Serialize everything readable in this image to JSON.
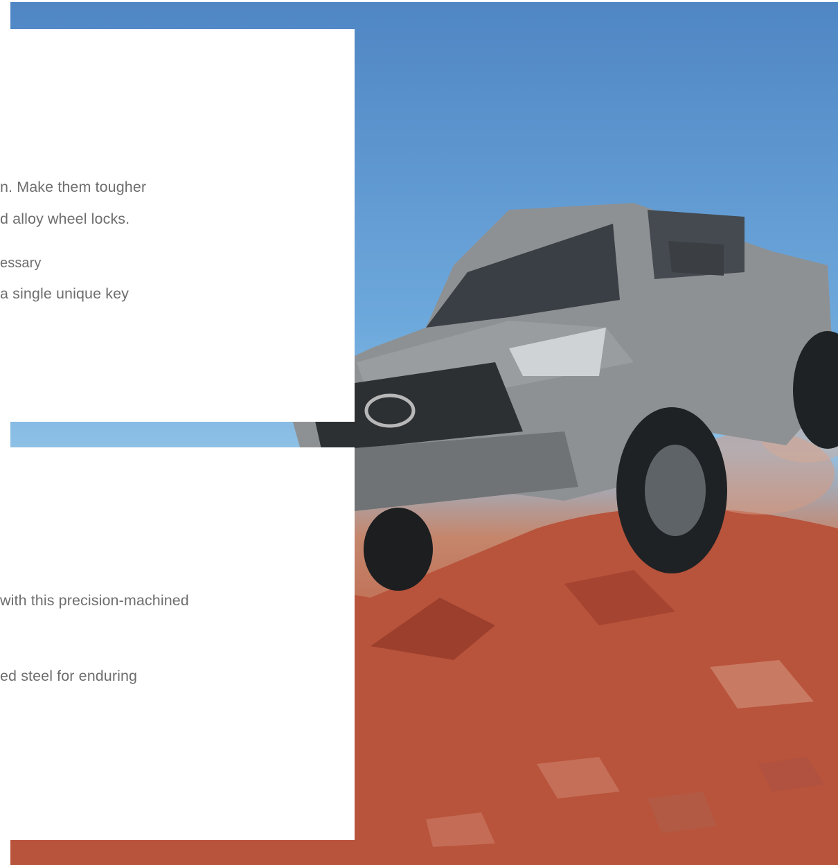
{
  "colors": {
    "sky_top": "#4f86c4",
    "sky_bottom": "#8fc1e6",
    "dirt": "#bb5d43",
    "truck_body": "#8e9193",
    "panel": "#ffffff",
    "body_text": "#6e6e6e"
  },
  "photo": {
    "subject": "grey Toyota pickup truck climbing red rocky hill"
  },
  "panel_top": {
    "line_1": "n. Make them tougher",
    "line_2": "d alloy wheel locks.",
    "line_3": "essary",
    "line_4": "a single unique key"
  },
  "panel_bottom": {
    "line_1": "with this precision-machined",
    "line_2": "ed steel for enduring"
  }
}
